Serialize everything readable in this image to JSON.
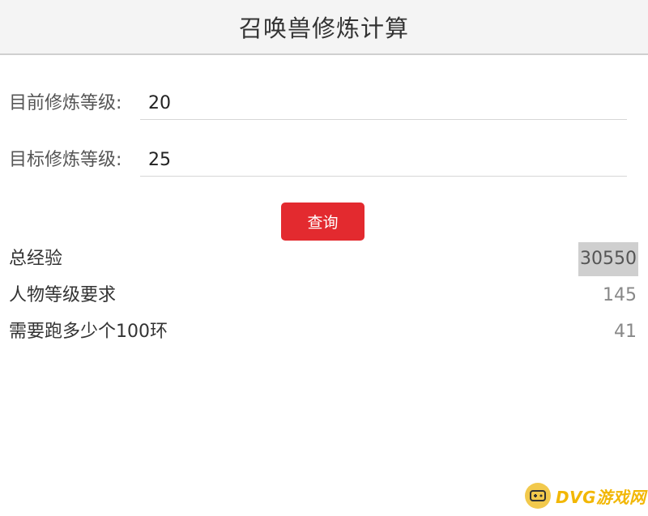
{
  "header": {
    "title": "召唤兽修炼计算"
  },
  "form": {
    "current_level": {
      "label": "目前修炼等级:",
      "value": "20"
    },
    "target_level": {
      "label": "目标修炼等级:",
      "value": "25"
    },
    "query_button": "查询"
  },
  "results": [
    {
      "label": "总经验",
      "value": "30550"
    },
    {
      "label": "人物等级要求",
      "value": "145"
    },
    {
      "label": "需要跑多少个100环",
      "value": "41"
    }
  ],
  "watermark": {
    "text": "DVG游戏网",
    "icon": "gamepad-icon"
  },
  "colors": {
    "accent": "#e32a2f",
    "header_bg": "#f4f4f4",
    "watermark": "#f2b705"
  }
}
